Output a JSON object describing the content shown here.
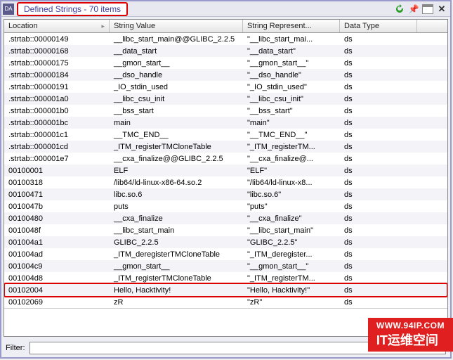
{
  "title": "Defined Strings - 70 items",
  "columns": {
    "location": "Location",
    "value": "String Value",
    "repr": "String Represent...",
    "datatype": "Data Type"
  },
  "rows": [
    {
      "loc": ".strtab::00000149",
      "val": "__libc_start_main@@GLIBC_2.2.5",
      "rep": "\"__libc_start_mai...",
      "dt": "ds",
      "hl": false
    },
    {
      "loc": ".strtab::00000168",
      "val": "__data_start",
      "rep": "\"__data_start\"",
      "dt": "ds",
      "hl": false
    },
    {
      "loc": ".strtab::00000175",
      "val": "__gmon_start__",
      "rep": "\"__gmon_start__\"",
      "dt": "ds",
      "hl": false
    },
    {
      "loc": ".strtab::00000184",
      "val": "__dso_handle",
      "rep": "\"__dso_handle\"",
      "dt": "ds",
      "hl": false
    },
    {
      "loc": ".strtab::00000191",
      "val": "_IO_stdin_used",
      "rep": "\"_IO_stdin_used\"",
      "dt": "ds",
      "hl": false
    },
    {
      "loc": ".strtab::000001a0",
      "val": "__libc_csu_init",
      "rep": "\"__libc_csu_init\"",
      "dt": "ds",
      "hl": false
    },
    {
      "loc": ".strtab::000001b0",
      "val": "__bss_start",
      "rep": "\"__bss_start\"",
      "dt": "ds",
      "hl": false
    },
    {
      "loc": ".strtab::000001bc",
      "val": "main",
      "rep": "\"main\"",
      "dt": "ds",
      "hl": false
    },
    {
      "loc": ".strtab::000001c1",
      "val": "__TMC_END__",
      "rep": "\"__TMC_END__\"",
      "dt": "ds",
      "hl": false
    },
    {
      "loc": ".strtab::000001cd",
      "val": "_ITM_registerTMCloneTable",
      "rep": "\"_ITM_registerTM...",
      "dt": "ds",
      "hl": false
    },
    {
      "loc": ".strtab::000001e7",
      "val": "__cxa_finalize@@GLIBC_2.2.5",
      "rep": "\"__cxa_finalize@...",
      "dt": "ds",
      "hl": false
    },
    {
      "loc": "00100001",
      "val": "ELF",
      "rep": "\"ELF\"",
      "dt": "ds",
      "hl": false
    },
    {
      "loc": "00100318",
      "val": "/lib64/ld-linux-x86-64.so.2",
      "rep": "\"/lib64/ld-linux-x8...",
      "dt": "ds",
      "hl": false
    },
    {
      "loc": "00100471",
      "val": "libc.so.6",
      "rep": "\"libc.so.6\"",
      "dt": "ds",
      "hl": false
    },
    {
      "loc": "0010047b",
      "val": "puts",
      "rep": "\"puts\"",
      "dt": "ds",
      "hl": false
    },
    {
      "loc": "00100480",
      "val": "__cxa_finalize",
      "rep": "\"__cxa_finalize\"",
      "dt": "ds",
      "hl": false
    },
    {
      "loc": "0010048f",
      "val": "__libc_start_main",
      "rep": "\"__libc_start_main\"",
      "dt": "ds",
      "hl": false
    },
    {
      "loc": "001004a1",
      "val": "GLIBC_2.2.5",
      "rep": "\"GLIBC_2.2.5\"",
      "dt": "ds",
      "hl": false
    },
    {
      "loc": "001004ad",
      "val": "_ITM_deregisterTMCloneTable",
      "rep": "\"_ITM_deregister...",
      "dt": "ds",
      "hl": false
    },
    {
      "loc": "001004c9",
      "val": "__gmon_start__",
      "rep": "\"__gmon_start__\"",
      "dt": "ds",
      "hl": false
    },
    {
      "loc": "001004d8",
      "val": "_ITM_registerTMCloneTable",
      "rep": "\"_ITM_registerTM...",
      "dt": "ds",
      "hl": false
    },
    {
      "loc": "00102004",
      "val": "Hello, Hacktivity!",
      "rep": "\"Hello, Hacktivity!\"",
      "dt": "ds",
      "hl": true
    },
    {
      "loc": "00102069",
      "val": "zR",
      "rep": "\"zR\"",
      "dt": "ds",
      "hl": false
    }
  ],
  "filter": {
    "label": "Filter:",
    "value": ""
  },
  "watermark": {
    "url": "WWW.94IP.COM",
    "cn": "IT运维空间"
  }
}
